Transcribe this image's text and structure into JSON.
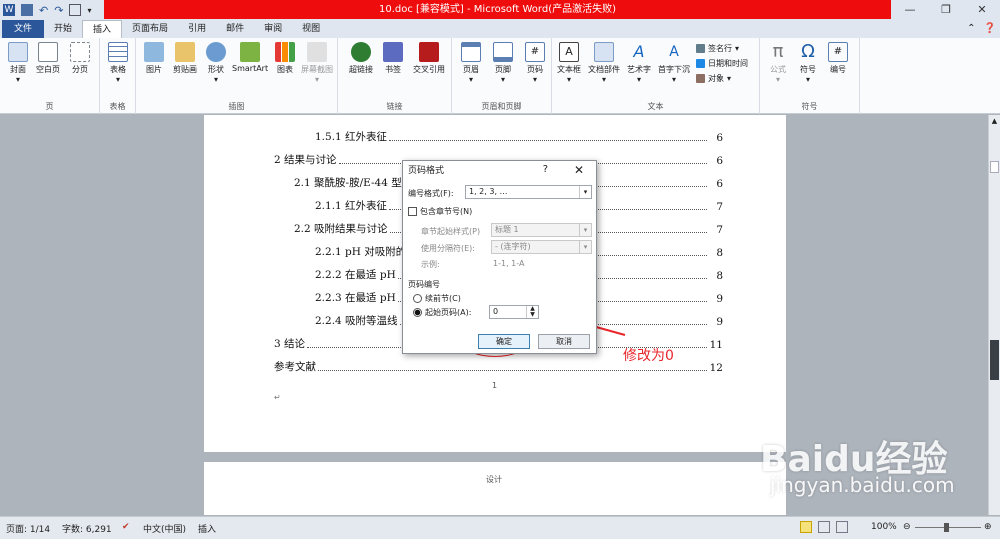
{
  "titlebar": {
    "title": "10.doc [兼容模式] - Microsoft Word(产品激活失败)"
  },
  "tabs": {
    "file": "文件",
    "items": [
      "开始",
      "插入",
      "页面布局",
      "引用",
      "邮件",
      "审阅",
      "视图"
    ],
    "active": "插入"
  },
  "ribbon": {
    "pages": {
      "label": "页",
      "cover": "封面",
      "blank": "空白页",
      "break": "分页"
    },
    "tables": {
      "label": "表格",
      "table": "表格"
    },
    "illus": {
      "label": "插图",
      "picture": "图片",
      "clipart": "剪贴画",
      "shapes": "形状",
      "smartart": "SmartArt",
      "chart": "图表",
      "screenshot": "屏幕截图"
    },
    "links": {
      "label": "链接",
      "hyperlink": "超链接",
      "bookmark": "书签",
      "crossref": "交叉引用"
    },
    "hf": {
      "label": "页眉和页脚",
      "header": "页眉",
      "footer": "页脚",
      "pagenum": "页码"
    },
    "text": {
      "label": "文本",
      "textbox": "文本框",
      "parts": "文档部件",
      "wordart": "艺术字",
      "dropcap": "首字下沉",
      "signature": "签名行",
      "datetime": "日期和时间",
      "object": "对象"
    },
    "symbols": {
      "label": "符号",
      "equation": "公式",
      "symbol": "符号",
      "number": "编号"
    }
  },
  "document": {
    "toc": [
      {
        "text": "1.5.1  红外表征",
        "page": "6"
      },
      {
        "text": "2  结果与讨论",
        "page": "6"
      },
      {
        "text": "2.1  聚酰胺-胺/E-44 型",
        "page": "6"
      },
      {
        "text": "2.1.1  红外表征",
        "page": "7"
      },
      {
        "text": "2.2  吸附结果与讨论",
        "page": "7"
      },
      {
        "text": "2.2.1 pH 对吸附的",
        "page": "8"
      },
      {
        "text": "2.2.2  在最适 pH",
        "page": "8"
      },
      {
        "text": "2.2.3  在最适 pH",
        "page": "9"
      },
      {
        "text": "2.2.4  吸附等温线",
        "page": "9"
      },
      {
        "text": "3  结论",
        "page": "11"
      },
      {
        "text": "参考文献",
        "page": "12"
      }
    ],
    "footer_pagenum": "1",
    "page2_footer": "设计"
  },
  "dialog": {
    "title": "页码格式",
    "help": "?",
    "close": "✕",
    "format_label": "编号格式(F):",
    "format_value": "1, 2, 3, …",
    "include_chapter": "包含章节号(N)",
    "chapter_style_label": "章节起始样式(P)",
    "chapter_style_value": "标题 1",
    "separator_label": "使用分隔符(E):",
    "separator_value": "-  (连字符)",
    "example_label": "示例:",
    "example_value": "1-1, 1-A",
    "numbering_label": "页码编号",
    "continue_label": "续前节(C)",
    "start_label": "起始页码(A):",
    "start_value": "0",
    "ok": "确定",
    "cancel": "取消"
  },
  "annotation": "修改为0",
  "watermark": {
    "brand": "Baidu经验",
    "url": "jingyan.baidu.com"
  },
  "status": {
    "page": "页面: 1/14",
    "words": "字数: 6,291",
    "lang": "中文(中国)",
    "mode": "插入",
    "zoom": "100%"
  }
}
